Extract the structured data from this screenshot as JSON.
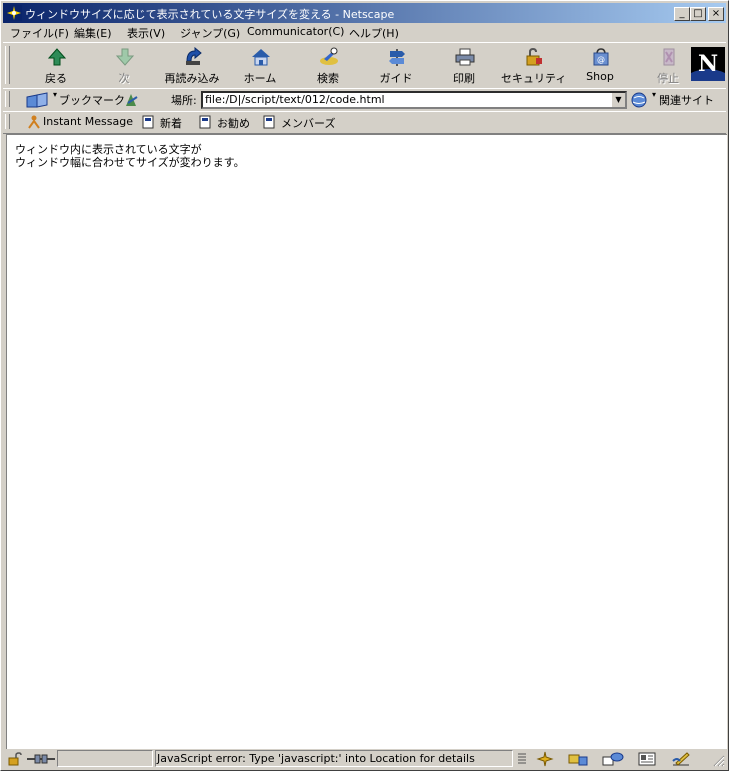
{
  "window": {
    "title": "ウィンドウサイズに応じて表示されている文字サイズを変える - Netscape",
    "minimize": "_",
    "maximize": "□",
    "close": "×"
  },
  "menu": [
    "ファイル(F)",
    "編集(E)",
    "表示(V)",
    "ジャンプ(G)",
    "Communicator(C)",
    "ヘルプ(H)"
  ],
  "toolbar": {
    "back": "戻る",
    "forward": "次",
    "reload": "再読み込み",
    "home": "ホーム",
    "search": "検索",
    "guide": "ガイド",
    "print": "印刷",
    "security": "セキュリティ",
    "shop": "Shop",
    "stop": "停止"
  },
  "location": {
    "bookmarks": "ブックマーク",
    "label": "場所:",
    "url": "file:/D|/script/text/012/code.html",
    "related": "関連サイト"
  },
  "personal": {
    "instant_message": "Instant Message",
    "new": "新着",
    "recommend": "お勧め",
    "members": "メンバーズ"
  },
  "content": {
    "line1": "ウィンドウ内に表示されている文字が",
    "line2": "ウィンドウ幅に合わせてサイズが変わります。"
  },
  "status": {
    "text": "JavaScript error: Type 'javascript:' into Location for details"
  }
}
